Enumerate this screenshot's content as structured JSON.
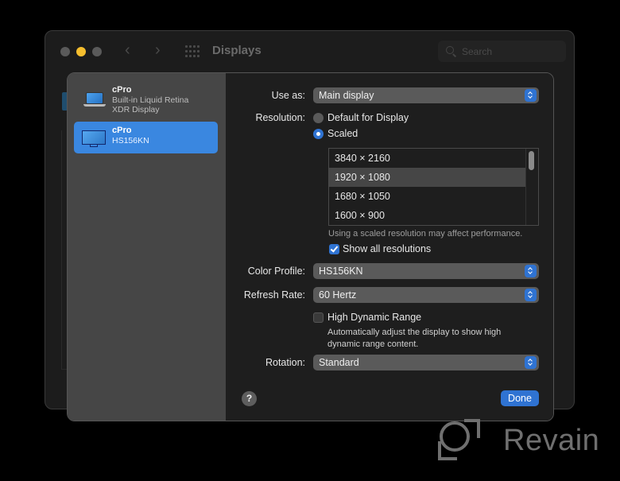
{
  "window": {
    "title": "Displays",
    "search_placeholder": "Search",
    "traffic_lights": {
      "close": "#5a5a5a",
      "minimize": "#f5be2e",
      "zoom": "#5a5a5a"
    }
  },
  "sidebar": {
    "items": [
      {
        "name": "cPro",
        "subtitle_line1": "Built-in Liquid Retina",
        "subtitle_line2": "XDR Display",
        "icon": "laptop-icon",
        "selected": false
      },
      {
        "name": "cPro",
        "subtitle_line1": "HS156KN",
        "subtitle_line2": "",
        "icon": "monitor-icon",
        "selected": true
      }
    ]
  },
  "settings": {
    "use_as": {
      "label": "Use as:",
      "value": "Main display"
    },
    "resolution": {
      "label": "Resolution:",
      "options": [
        {
          "label": "Default for Display",
          "selected": false
        },
        {
          "label": "Scaled",
          "selected": true
        }
      ],
      "list": [
        {
          "value": "3840 × 2160",
          "selected": false
        },
        {
          "value": "1920 × 1080",
          "selected": true
        },
        {
          "value": "1680 × 1050",
          "selected": false
        },
        {
          "value": "1600 × 900",
          "selected": false
        }
      ],
      "note": "Using a scaled resolution may affect performance.",
      "show_all": {
        "label": "Show all resolutions",
        "checked": true
      }
    },
    "color_profile": {
      "label": "Color Profile:",
      "value": "HS156KN"
    },
    "refresh_rate": {
      "label": "Refresh Rate:",
      "value": "60 Hertz"
    },
    "hdr": {
      "label": "High Dynamic Range",
      "checked": false,
      "description_line1": "Automatically adjust the display to show high",
      "description_line2": "dynamic range content."
    },
    "rotation": {
      "label": "Rotation:",
      "value": "Standard"
    }
  },
  "footer": {
    "help_label": "?",
    "done_label": "Done"
  },
  "watermark": {
    "text": "Revain"
  },
  "colors": {
    "accent": "#2f73d2",
    "selection": "#3a87e0"
  }
}
